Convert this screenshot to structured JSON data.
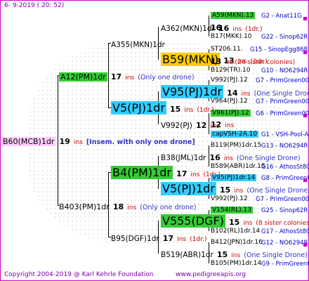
{
  "header": "6-  9-2019 ( 20: 52)",
  "footer": {
    "copyright": "Copyright 2004-2019 @ Karl Kehrle Foundation",
    "url": "www.pedigreeapis.org"
  },
  "root": {
    "label": "B60(MCB)1dr",
    "num": "19",
    "ins": "ins",
    "note": "[Insem. with only one drone]"
  },
  "g1": [
    {
      "label": "A12(PM)1dr",
      "num": "17",
      "ins": "ins",
      "note": "(Only one drone)"
    },
    {
      "label": "B403(PM)1dr",
      "num": "18",
      "ins": "ins",
      "note": "(Only one drone)"
    }
  ],
  "g2": [
    {
      "label": "A355(MKN)1dr"
    },
    {
      "label": "V5(PJ)1dr",
      "num": "15",
      "ins": "ins",
      "note": "(1dr.)"
    },
    {
      "label": "B4(PM)1dr",
      "num": "17",
      "ins": "ins",
      "note": "(1dr.)"
    },
    {
      "label": "B95(DGF)1dr",
      "num": "17",
      "ins": "ins",
      "note": "(1dr.)"
    }
  ],
  "g3": [
    {
      "label": "A362(MKN)1dr",
      "num": "16",
      "ins": "ins",
      "note": "(1dr.)"
    },
    {
      "label": "B59(MKN)",
      "num": "13",
      "ins": "ins",
      "note": "(1dr.)"
    },
    {
      "label": "V95(PJ)1dr",
      "num": "14",
      "ins": "ins",
      "note": "(One Single Drone)"
    },
    {
      "label": "V992(PJ)",
      "num": "12",
      "ins": "ins"
    },
    {
      "label": "B38(JML)1dr",
      "num": "16",
      "ins": "ins",
      "note": "(One Single Drone)"
    },
    {
      "label": "V5(PJ)1dr",
      "num": "15",
      "ins": "ins",
      "note": "(One Single Drone)"
    },
    {
      "label": "V555(DGF)",
      "num": "15",
      "ins": "ins",
      "note": "(8 sister colonies)"
    },
    {
      "label": "B519(ABR)1dr",
      "num": "15",
      "ins": "ins",
      "note": "(One Single Drone)"
    }
  ],
  "g4": [
    {
      "label": "A59(MKN).13",
      "ref": "G2 - Anat11G"
    },
    {
      "label": "B17(MKK).10",
      "ref": "G22 - Sinop62R"
    },
    {
      "label": "ST206.11.",
      "ref": "G15 - SinopEgg86R"
    },
    {
      "label": "B129(TR).10",
      "ref": "G10 - NO6294R"
    },
    {
      "label": "V992(PJ).12",
      "ref": "G7 - PrimGreen00"
    },
    {
      "label": "V964(PJ).12",
      "ref": "G7 - PrimGreen00"
    },
    {
      "label": "V961(PJ).12",
      "ref": "G6 - PrimGreen00"
    },
    {
      "label": "capVSH-2A.10",
      "ref": "G1 - VSH-Pool-AR"
    },
    {
      "label": "B119(PM)1dr.15",
      "ref": "G13 - NO6294R"
    },
    {
      "label": "B589(ABR)1dr.15",
      "ref": "G16 - AthosSt80R"
    },
    {
      "label": "V95(PJ)1dr.14",
      "ref": "G8 - PrimGreen00"
    },
    {
      "label": "V992(PJ).12",
      "ref": "G7 - PrimGreen00"
    },
    {
      "label": "V154(RL).13",
      "ref": "G25 - Sinop62R"
    },
    {
      "label": "B102(RL)1dr.14",
      "ref": "G17 - AthosSt80R"
    },
    {
      "label": "B412(JPN)1dr.16",
      "ref": "G12 - NO6294R"
    },
    {
      "label": "B105(PM)1dr.14",
      "ref": "G9 - PrimGreen00"
    }
  ],
  "extra": {
    "b59_sub_num": "13",
    "b59_sub_note": "mk(24 sister colonies)",
    "v992_num": "12",
    "v992_ins": "ins"
  }
}
